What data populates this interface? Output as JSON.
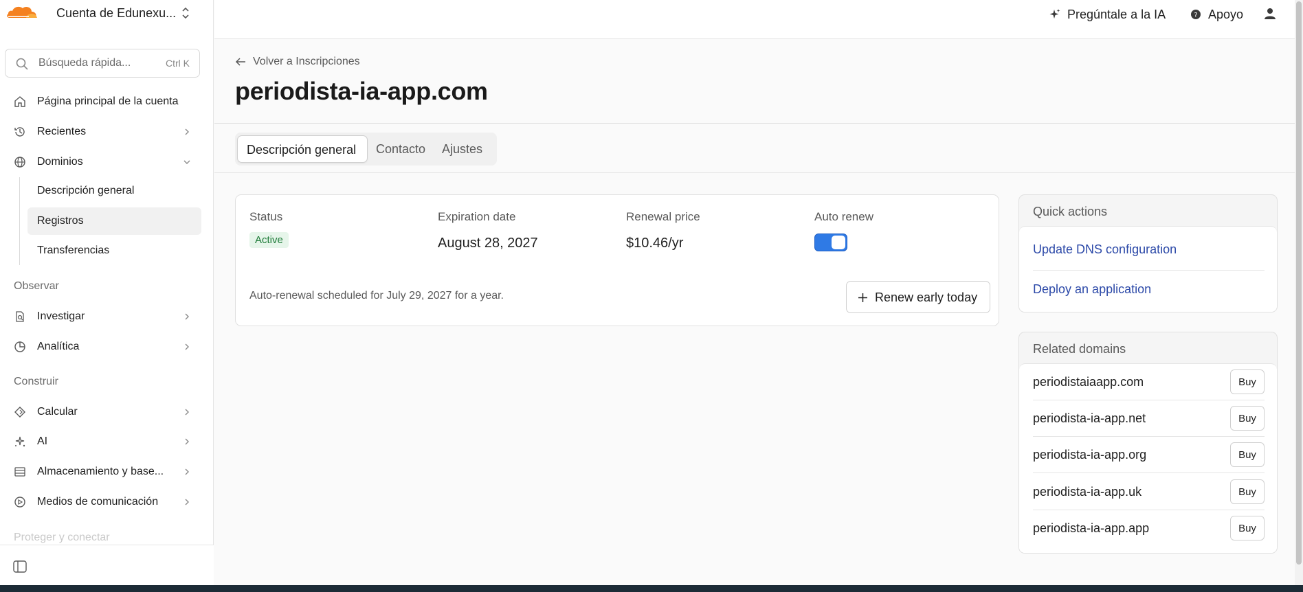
{
  "account": {
    "name": "Cuenta de Edunexu..."
  },
  "search": {
    "placeholder": "Búsqueda rápida...",
    "shortcut": "Ctrl K"
  },
  "sidebar": {
    "home": "Página principal de la cuenta",
    "recent": "Recientes",
    "domains": "Dominios",
    "domains_sub": [
      "Descripción general",
      "Registros",
      "Transferencias"
    ],
    "section_observe": "Observar",
    "investigate": "Investigar",
    "analytics": "Analítica",
    "section_build": "Construir",
    "compute": "Calcular",
    "ai": "AI",
    "storage": "Almacenamiento y base...",
    "media": "Medios de comunicación",
    "section_protect": "Proteger y conectar"
  },
  "topbar": {
    "ask_ai": "Pregúntale a la IA",
    "support": "Apoyo"
  },
  "page": {
    "back_label": "Volver a Inscripciones",
    "title": "periodista-ia-app.com",
    "tabs": [
      "Descripción general",
      "Contacto",
      "Ajustes"
    ]
  },
  "overview": {
    "status_label": "Status",
    "status_value": "Active",
    "expiration_label": "Expiration date",
    "expiration_value": "August 28, 2027",
    "price_label": "Renewal price",
    "price_value": "$10.46/yr",
    "auto_renew_label": "Auto renew",
    "auto_renew_on": true,
    "note": "Auto-renewal scheduled for July 29, 2027 for a year.",
    "renew_button": "Renew early today"
  },
  "quick_actions": {
    "title": "Quick actions",
    "links": [
      "Update DNS configuration",
      "Deploy an application"
    ]
  },
  "related_domains": {
    "title": "Related domains",
    "buy_label": "Buy",
    "items": [
      "periodistaiaapp.com",
      "periodista-ia-app.net",
      "periodista-ia-app.org",
      "periodista-ia-app.uk",
      "periodista-ia-app.app"
    ]
  },
  "colors": {
    "brand_orange": "#f48120",
    "link_blue": "#2c49a8",
    "toggle_blue": "#2f7ae5",
    "status_green": "#1c7a37"
  }
}
